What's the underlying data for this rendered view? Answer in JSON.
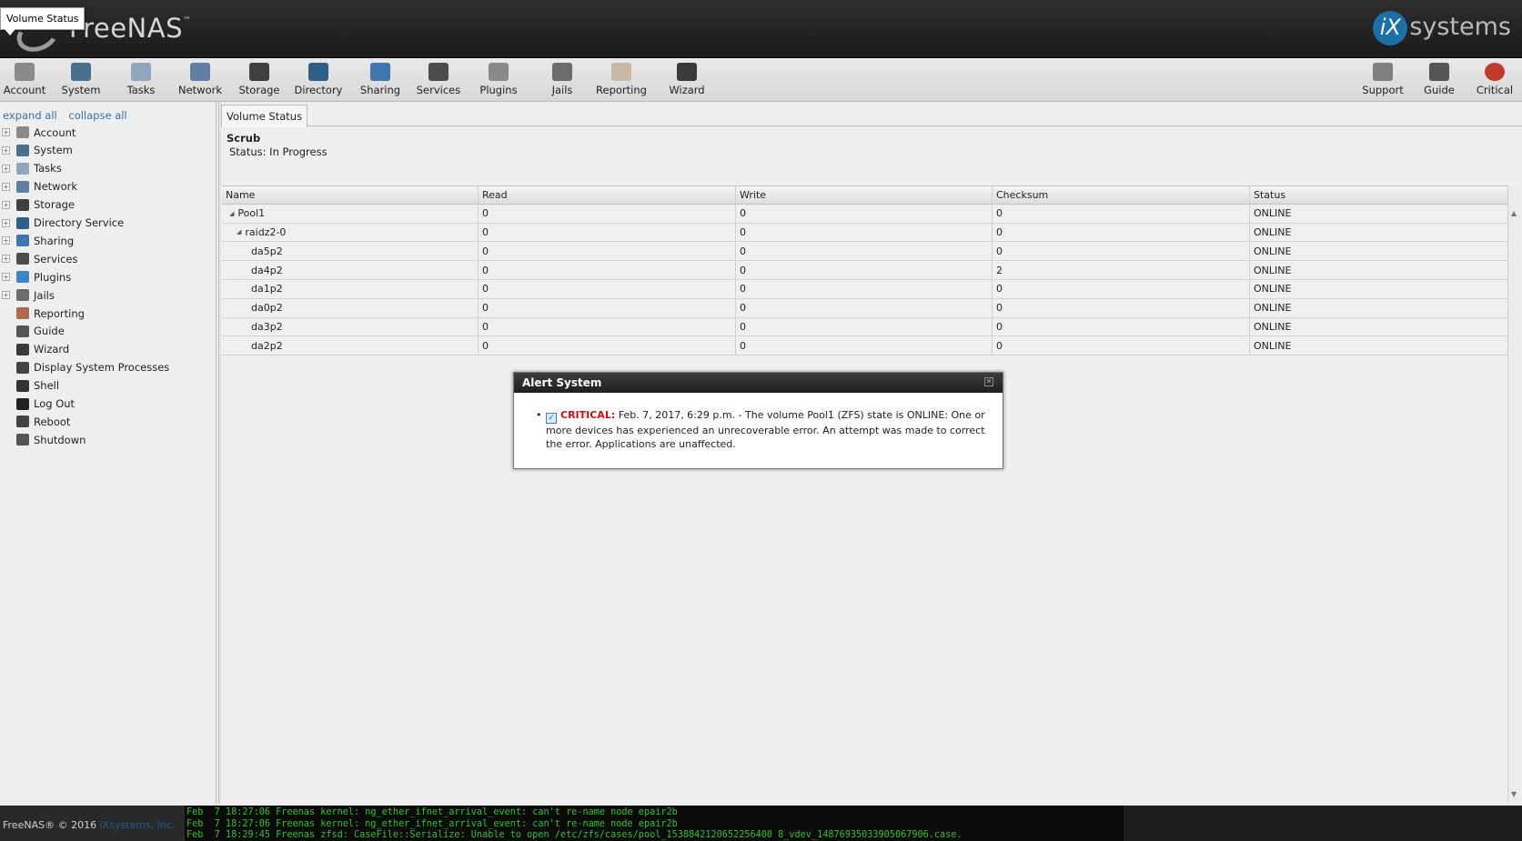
{
  "tooltip": "Volume Status",
  "header": {
    "logo_text": "FreeNAS",
    "vendor_logo_mark": "iX",
    "vendor_logo_text": "systems"
  },
  "toolbar": {
    "left": [
      {
        "label": "Account",
        "icon": "account-icon",
        "color": "#8a8a8a"
      },
      {
        "label": "System",
        "icon": "system-icon",
        "color": "#4d6f8f"
      },
      {
        "label": "Tasks",
        "icon": "tasks-icon",
        "color": "#8fa6bd"
      },
      {
        "label": "Network",
        "icon": "network-icon",
        "color": "#5f7fa4"
      },
      {
        "label": "Storage",
        "icon": "storage-icon",
        "color": "#3f3f3f"
      },
      {
        "label": "Directory",
        "icon": "directory-icon",
        "color": "#2f5f86"
      },
      {
        "label": "Sharing",
        "icon": "sharing-icon",
        "color": "#3d77b0"
      },
      {
        "label": "Services",
        "icon": "services-icon",
        "color": "#4c4c4c"
      },
      {
        "label": "Plugins",
        "icon": "plugins-icon",
        "color": "#8a8a8a"
      },
      {
        "label": "Jails",
        "icon": "jails-icon",
        "color": "#6c6c6c"
      },
      {
        "label": "Reporting",
        "icon": "reporting-icon",
        "color": "#c8b8a8"
      },
      {
        "label": "Wizard",
        "icon": "wizard-icon",
        "color": "#3a3a3a"
      }
    ],
    "right": [
      {
        "label": "Support",
        "icon": "support-icon",
        "color": "#7f7f7f"
      },
      {
        "label": "Guide",
        "icon": "guide-icon",
        "color": "#555555"
      },
      {
        "label": "Critical",
        "icon": "critical-alert-icon",
        "color": "#c0392b"
      }
    ]
  },
  "sidebar": {
    "expand_all": "expand all",
    "collapse_all": "collapse all",
    "items": [
      {
        "label": "Account",
        "icon": "account-icon",
        "expandable": true
      },
      {
        "label": "System",
        "icon": "system-icon",
        "expandable": true
      },
      {
        "label": "Tasks",
        "icon": "tasks-icon",
        "expandable": true
      },
      {
        "label": "Network",
        "icon": "network-icon",
        "expandable": true
      },
      {
        "label": "Storage",
        "icon": "storage-icon",
        "expandable": true
      },
      {
        "label": "Directory Service",
        "icon": "directory-icon",
        "expandable": true
      },
      {
        "label": "Sharing",
        "icon": "sharing-icon",
        "expandable": true
      },
      {
        "label": "Services",
        "icon": "services-icon",
        "expandable": true
      },
      {
        "label": "Plugins",
        "icon": "plugins-icon",
        "expandable": true
      },
      {
        "label": "Jails",
        "icon": "jails-icon",
        "expandable": true
      },
      {
        "label": "Reporting",
        "icon": "reporting-icon",
        "expandable": false
      },
      {
        "label": "Guide",
        "icon": "guide-icon",
        "expandable": false
      },
      {
        "label": "Wizard",
        "icon": "wizard-icon",
        "expandable": false
      },
      {
        "label": "Display System Processes",
        "icon": "processes-icon",
        "expandable": false
      },
      {
        "label": "Shell",
        "icon": "shell-icon",
        "expandable": false
      },
      {
        "label": "Log Out",
        "icon": "logout-icon",
        "expandable": false
      },
      {
        "label": "Reboot",
        "icon": "reboot-icon",
        "expandable": false
      },
      {
        "label": "Shutdown",
        "icon": "shutdown-icon",
        "expandable": false
      }
    ]
  },
  "main": {
    "tab": "Volume Status",
    "scrub_title": "Scrub",
    "scrub_status": "Status: In Progress",
    "columns": [
      "Name",
      "Read",
      "Write",
      "Checksum",
      "Status"
    ],
    "rows": [
      {
        "name": "Pool1",
        "level": 0,
        "tree": true,
        "read": "0",
        "write": "0",
        "checksum": "0",
        "status": "ONLINE"
      },
      {
        "name": "raidz2-0",
        "level": 1,
        "tree": true,
        "read": "0",
        "write": "0",
        "checksum": "0",
        "status": "ONLINE"
      },
      {
        "name": "da5p2",
        "level": 2,
        "tree": false,
        "read": "0",
        "write": "0",
        "checksum": "0",
        "status": "ONLINE"
      },
      {
        "name": "da4p2",
        "level": 2,
        "tree": false,
        "read": "0",
        "write": "0",
        "checksum": "2",
        "status": "ONLINE"
      },
      {
        "name": "da1p2",
        "level": 2,
        "tree": false,
        "read": "0",
        "write": "0",
        "checksum": "0",
        "status": "ONLINE"
      },
      {
        "name": "da0p2",
        "level": 2,
        "tree": false,
        "read": "0",
        "write": "0",
        "checksum": "0",
        "status": "ONLINE"
      },
      {
        "name": "da3p2",
        "level": 2,
        "tree": false,
        "read": "0",
        "write": "0",
        "checksum": "0",
        "status": "ONLINE"
      },
      {
        "name": "da2p2",
        "level": 2,
        "tree": false,
        "read": "0",
        "write": "0",
        "checksum": "0",
        "status": "ONLINE"
      }
    ]
  },
  "dialog": {
    "title": "Alert System",
    "alert_level": "CRITICAL:",
    "alert_message": "Feb. 7, 2017, 6:29 p.m. - The volume Pool1 (ZFS) state is ONLINE: One or more devices has experienced an unrecoverable error. An attempt was made to correct the error. Applications are unaffected."
  },
  "footer": {
    "copyright": "FreeNAS® © 2016",
    "company": "iXsystems, Inc.",
    "console_lines": [
      "Feb  7 18:27:06 Freenas kernel: ng_ether_ifnet_arrival_event: can't re-name node epair2b",
      "Feb  7 18:27:06 Freenas kernel: ng_ether_ifnet_arrival_event: can't re-name node epair2b",
      "Feb  7 18:29:45 Freenas zfsd: CaseFile::Serialize: Unable to open /etc/zfs/cases/pool_1538842120652256400 8_vdev_14876935033905067906.case."
    ]
  }
}
